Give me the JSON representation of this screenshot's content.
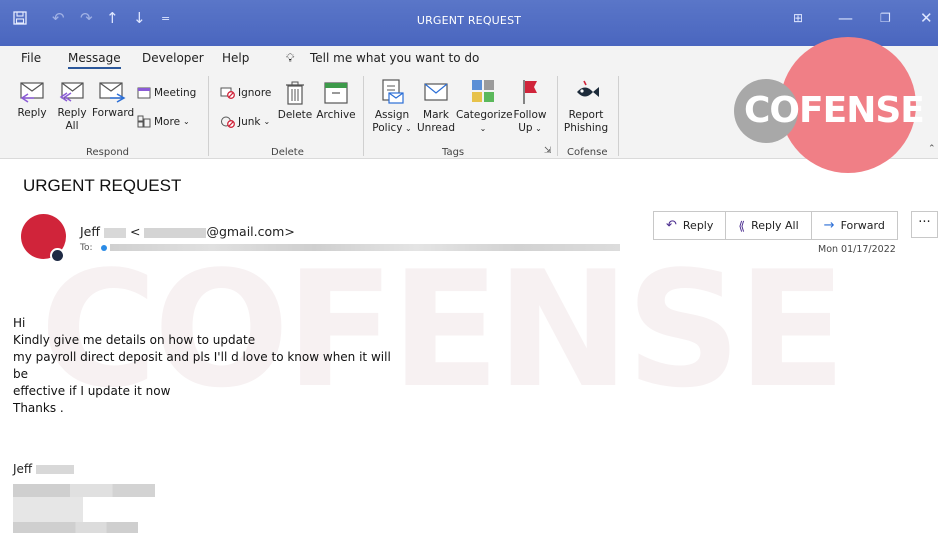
{
  "window": {
    "title": "URGENT REQUEST"
  },
  "menu": {
    "items": [
      "File",
      "Message",
      "Developer",
      "Help"
    ],
    "active": "Message",
    "tell_me": "Tell me what you want to do"
  },
  "ribbon": {
    "respond": {
      "label": "Respond",
      "reply": "Reply",
      "reply_all_1": "Reply",
      "reply_all_2": "All",
      "forward": "Forward",
      "meeting": "Meeting",
      "more": "More"
    },
    "delete": {
      "label": "Delete",
      "ignore": "Ignore",
      "junk": "Junk",
      "delete": "Delete",
      "archive": "Archive"
    },
    "tags": {
      "label": "Tags",
      "assign_1": "Assign",
      "assign_2": "Policy",
      "mark_1": "Mark",
      "mark_2": "Unread",
      "categorize": "Categorize",
      "follow_1": "Follow",
      "follow_2": "Up"
    },
    "cofense": {
      "label": "Cofense",
      "report_1": "Report",
      "report_2": "Phishing"
    }
  },
  "watermark": {
    "logo_text": "COFENSE"
  },
  "email": {
    "subject": "URGENT REQUEST",
    "sender_first": "Jeff",
    "sender_email_suffix": "@gmail.com>",
    "to_label": "To:",
    "date": "Mon 01/17/2022",
    "actions": {
      "reply": "Reply",
      "reply_all": "Reply All",
      "forward": "Forward",
      "more": "···"
    },
    "body": [
      "Hi",
      "Kindly give me details on how to update",
      "my payroll direct deposit and pls I'll d love to know when it will",
      "be",
      "effective if I update it now",
      "Thanks ."
    ],
    "signature_name": "Jeff"
  },
  "colors": {
    "titlebar": "#4f6cc4",
    "avatar": "#d0243a",
    "accent": "#2b579a"
  }
}
